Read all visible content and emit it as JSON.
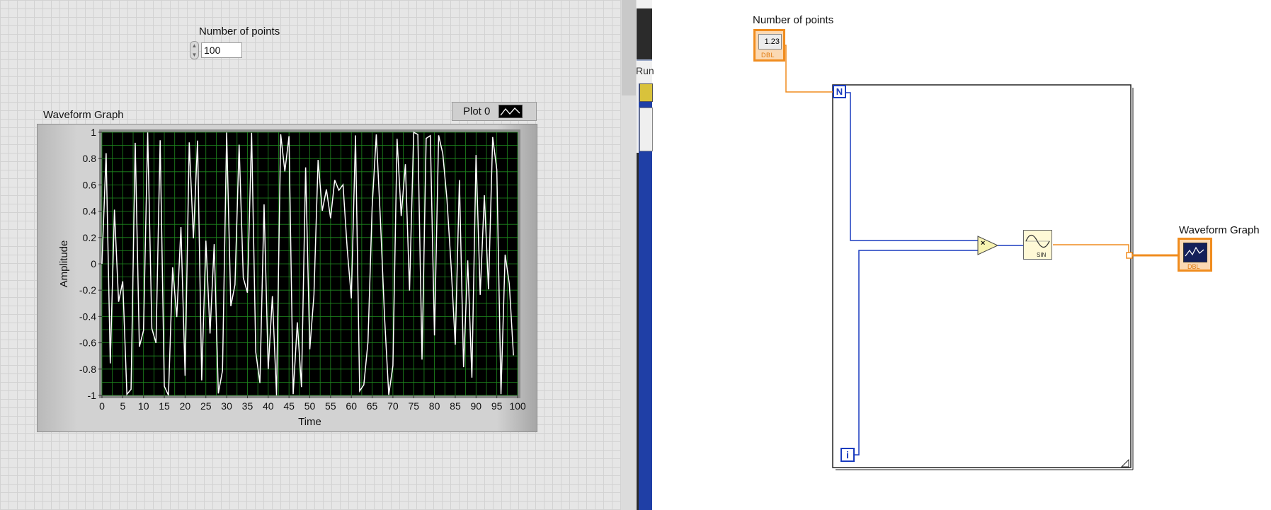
{
  "front_panel": {
    "control_label": "Number of points",
    "control_value": "100",
    "graph_label": "Waveform Graph",
    "legend_name": "Plot 0",
    "graph": {
      "xlabel": "Time",
      "ylabel": "Amplitude",
      "x_ticks": [
        "0",
        "5",
        "10",
        "15",
        "20",
        "25",
        "30",
        "35",
        "40",
        "45",
        "50",
        "55",
        "60",
        "65",
        "70",
        "75",
        "80",
        "85",
        "90",
        "95",
        "100"
      ],
      "y_ticks": [
        "1",
        "0.8",
        "0.6",
        "0.4",
        "0.2",
        "0",
        "-0.2",
        "-0.4",
        "-0.6",
        "-0.8",
        "-1"
      ]
    }
  },
  "chart_data": {
    "type": "line",
    "x_range": [
      0,
      99
    ],
    "xlim": [
      0,
      100
    ],
    "ylim": [
      -1,
      1
    ],
    "xlabel": "Time",
    "ylabel": "Amplitude",
    "series": [
      {
        "name": "Plot 0",
        "formula": "sin(i*i)",
        "n": 100
      }
    ],
    "grid": true,
    "legend": "top-right",
    "colors": {
      "plot_bg": "#000000",
      "grid": "#1f8a1f",
      "line": "#ffffff"
    }
  },
  "block_diagram": {
    "control_label": "Number of points",
    "control_text": "1.23",
    "control_type": "DBL",
    "count_terminal": "N",
    "iteration_terminal": "i",
    "multiply_symbol": "×",
    "sine_label": "SIN",
    "indicator_label": "Waveform Graph",
    "indicator_type": "DBL"
  },
  "colors": {
    "orange_wire": "#f08c1e",
    "blue_wire": "#1a3cbf"
  },
  "background_window": {
    "partial_text": "Run"
  }
}
